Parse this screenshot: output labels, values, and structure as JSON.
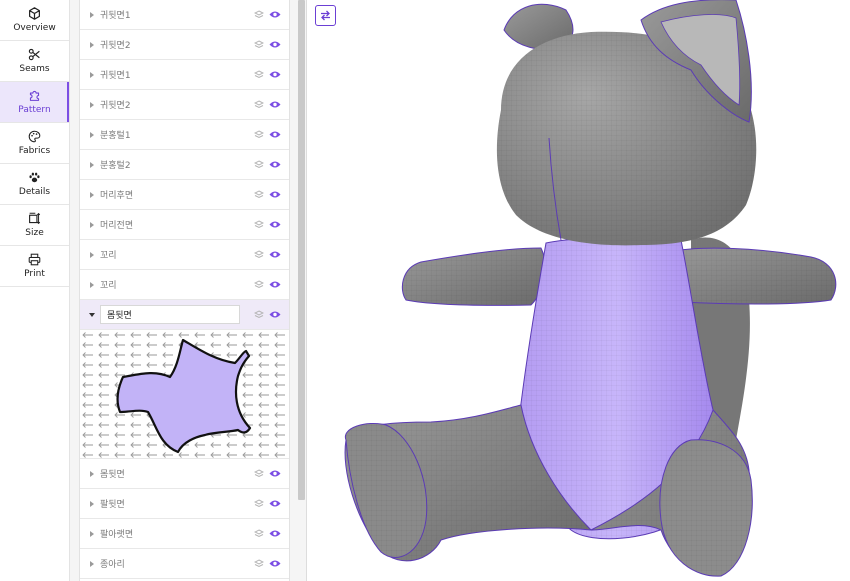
{
  "rail": {
    "items": [
      {
        "label": "Overview",
        "icon": "cube-icon"
      },
      {
        "label": "Seams",
        "icon": "scissors-icon"
      },
      {
        "label": "Pattern",
        "icon": "puzzle-icon",
        "active": true
      },
      {
        "label": "Fabrics",
        "icon": "palette-icon"
      },
      {
        "label": "Details",
        "icon": "paw-icon"
      },
      {
        "label": "Size",
        "icon": "resize-icon"
      },
      {
        "label": "Print",
        "icon": "printer-icon"
      }
    ]
  },
  "pieces": {
    "top": [
      "귀뒷면1",
      "귀뒷면2",
      "귀뒷면1",
      "귀뒷면2",
      "분홍털1",
      "분홍털2",
      "머리후면",
      "머리전면",
      "꼬리",
      "꼬리"
    ],
    "selected": {
      "name": "몸뒷면"
    },
    "bottom": [
      "몸뒷면",
      "팔뒷면",
      "팔아랫면",
      "종아리"
    ]
  },
  "colors": {
    "accent": "#7c4ee4",
    "fabric_purple": "#b9a3f5",
    "body_gray": "#8a8a8a"
  }
}
